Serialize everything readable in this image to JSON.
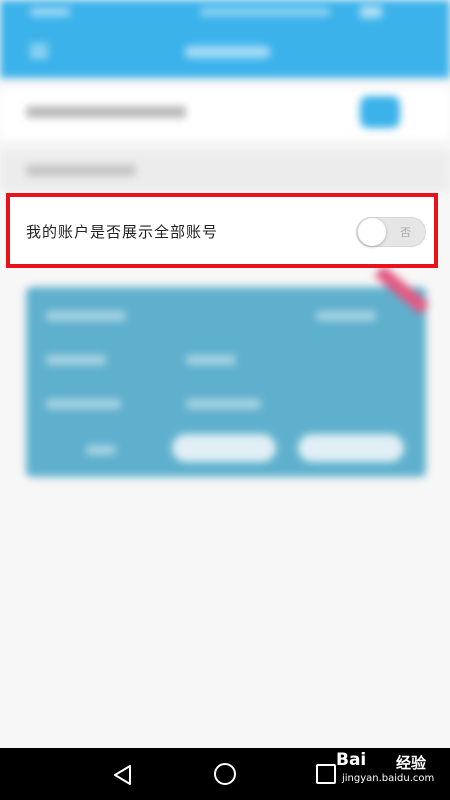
{
  "setting": {
    "label": "我的账户是否展示全部账号",
    "toggle_state": "否",
    "enabled": false
  },
  "watermark": {
    "logo": "Bai",
    "logo_suffix": "经验",
    "url": "jingyan.baidu.com"
  },
  "colors": {
    "app_bar": "#3bb2ea",
    "highlight": "#e8121b",
    "card": "#5fb0cd"
  },
  "icons": {
    "back": "triangle-back-icon",
    "home": "circle-home-icon",
    "recent": "square-recent-icon",
    "menu": "hamburger-icon"
  }
}
